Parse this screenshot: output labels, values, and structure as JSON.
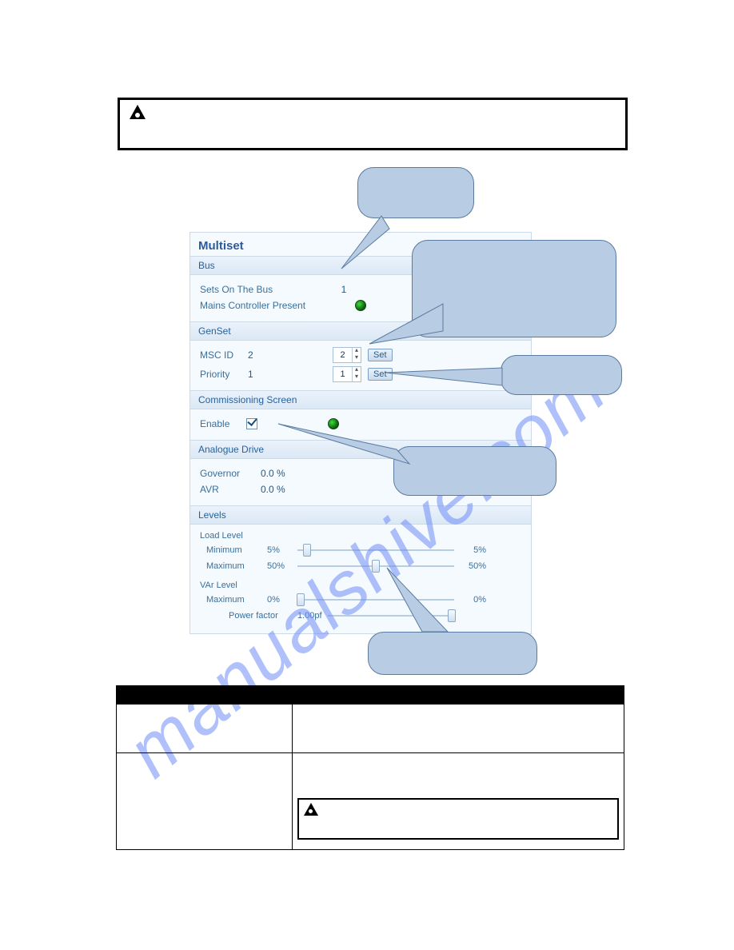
{
  "watermark": "manualshive.com",
  "panel": {
    "title": "Multiset",
    "bus": {
      "header": "Bus",
      "sets_label": "Sets On The Bus",
      "sets_value": "1",
      "mains_label": "Mains Controller Present"
    },
    "genset": {
      "header": "GenSet",
      "msc": {
        "label": "MSC ID",
        "current": "2",
        "spin": "2",
        "btn": "Set"
      },
      "prio": {
        "label": "Priority",
        "current": "1",
        "spin": "1",
        "btn": "Set"
      }
    },
    "comm": {
      "header": "Commissioning Screen",
      "enable_label": "Enable"
    },
    "analogue": {
      "header": "Analogue Drive",
      "gov_label": "Governor",
      "gov_val": "0.0 %",
      "avr_label": "AVR",
      "avr_val": "0.0 %"
    },
    "levels": {
      "header": "Levels",
      "load_header": "Load Level",
      "min_label": "Minimum",
      "min_val": "5%",
      "min_out": "5%",
      "max_label": "Maximum",
      "max_val": "50%",
      "max_out": "50%",
      "var_header": "VAr Level",
      "vmax_label": "Maximum",
      "vmax_val": "0%",
      "vmax_out": "0%",
      "pf_label": "Power factor",
      "pf_val": "1.00pf"
    }
  },
  "table_headers": {
    "c1": "",
    "c2": ""
  }
}
